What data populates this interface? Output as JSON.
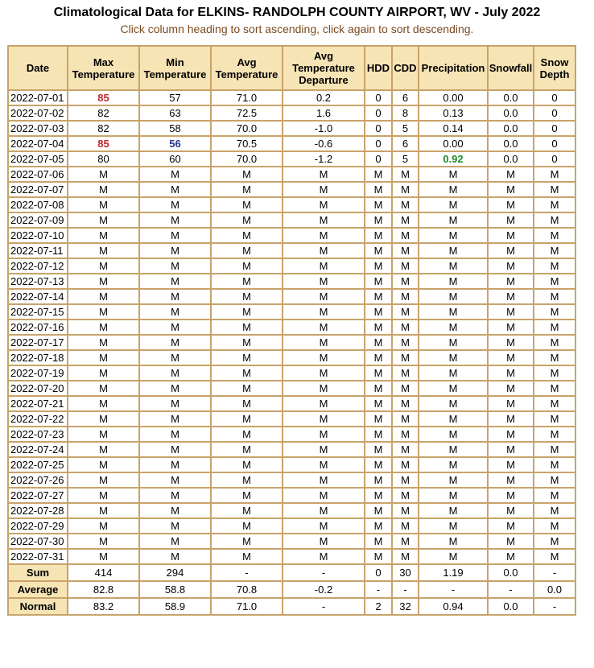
{
  "header": {
    "title": "Climatological Data for ELKINS- RANDOLPH COUNTY AIRPORT, WV - July 2022",
    "subtitle": "Click column heading to sort ascending, click again to sort descending."
  },
  "columns": [
    [
      "Date"
    ],
    [
      "Max",
      "Temperature"
    ],
    [
      "Min",
      "Temperature"
    ],
    [
      "Avg",
      "Temperature"
    ],
    [
      "Avg",
      "Temperature",
      "Departure"
    ],
    [
      "HDD"
    ],
    [
      "CDD"
    ],
    [
      "Precipitation"
    ],
    [
      "Snowfall"
    ],
    [
      "Snow",
      "Depth"
    ]
  ],
  "highlights": {
    "max_color": "#c0262b",
    "min_color": "#27338f",
    "precip_color": "#1e8a2e"
  },
  "rows": [
    {
      "cells": [
        "2022-07-01",
        "85",
        "57",
        "71.0",
        "0.2",
        "0",
        "6",
        "0.00",
        "0.0",
        "0"
      ],
      "hl": {
        "1": "hi"
      }
    },
    {
      "cells": [
        "2022-07-02",
        "82",
        "63",
        "72.5",
        "1.6",
        "0",
        "8",
        "0.13",
        "0.0",
        "0"
      ]
    },
    {
      "cells": [
        "2022-07-03",
        "82",
        "58",
        "70.0",
        "-1.0",
        "0",
        "5",
        "0.14",
        "0.0",
        "0"
      ]
    },
    {
      "cells": [
        "2022-07-04",
        "85",
        "56",
        "70.5",
        "-0.6",
        "0",
        "6",
        "0.00",
        "0.0",
        "0"
      ],
      "hl": {
        "1": "hi",
        "2": "lo"
      }
    },
    {
      "cells": [
        "2022-07-05",
        "80",
        "60",
        "70.0",
        "-1.2",
        "0",
        "5",
        "0.92",
        "0.0",
        "0"
      ],
      "hl": {
        "7": "pr"
      }
    },
    {
      "cells": [
        "2022-07-06",
        "M",
        "M",
        "M",
        "M",
        "M",
        "M",
        "M",
        "M",
        "M"
      ]
    },
    {
      "cells": [
        "2022-07-07",
        "M",
        "M",
        "M",
        "M",
        "M",
        "M",
        "M",
        "M",
        "M"
      ]
    },
    {
      "cells": [
        "2022-07-08",
        "M",
        "M",
        "M",
        "M",
        "M",
        "M",
        "M",
        "M",
        "M"
      ]
    },
    {
      "cells": [
        "2022-07-09",
        "M",
        "M",
        "M",
        "M",
        "M",
        "M",
        "M",
        "M",
        "M"
      ]
    },
    {
      "cells": [
        "2022-07-10",
        "M",
        "M",
        "M",
        "M",
        "M",
        "M",
        "M",
        "M",
        "M"
      ]
    },
    {
      "cells": [
        "2022-07-11",
        "M",
        "M",
        "M",
        "M",
        "M",
        "M",
        "M",
        "M",
        "M"
      ]
    },
    {
      "cells": [
        "2022-07-12",
        "M",
        "M",
        "M",
        "M",
        "M",
        "M",
        "M",
        "M",
        "M"
      ]
    },
    {
      "cells": [
        "2022-07-13",
        "M",
        "M",
        "M",
        "M",
        "M",
        "M",
        "M",
        "M",
        "M"
      ]
    },
    {
      "cells": [
        "2022-07-14",
        "M",
        "M",
        "M",
        "M",
        "M",
        "M",
        "M",
        "M",
        "M"
      ]
    },
    {
      "cells": [
        "2022-07-15",
        "M",
        "M",
        "M",
        "M",
        "M",
        "M",
        "M",
        "M",
        "M"
      ]
    },
    {
      "cells": [
        "2022-07-16",
        "M",
        "M",
        "M",
        "M",
        "M",
        "M",
        "M",
        "M",
        "M"
      ]
    },
    {
      "cells": [
        "2022-07-17",
        "M",
        "M",
        "M",
        "M",
        "M",
        "M",
        "M",
        "M",
        "M"
      ]
    },
    {
      "cells": [
        "2022-07-18",
        "M",
        "M",
        "M",
        "M",
        "M",
        "M",
        "M",
        "M",
        "M"
      ]
    },
    {
      "cells": [
        "2022-07-19",
        "M",
        "M",
        "M",
        "M",
        "M",
        "M",
        "M",
        "M",
        "M"
      ]
    },
    {
      "cells": [
        "2022-07-20",
        "M",
        "M",
        "M",
        "M",
        "M",
        "M",
        "M",
        "M",
        "M"
      ]
    },
    {
      "cells": [
        "2022-07-21",
        "M",
        "M",
        "M",
        "M",
        "M",
        "M",
        "M",
        "M",
        "M"
      ]
    },
    {
      "cells": [
        "2022-07-22",
        "M",
        "M",
        "M",
        "M",
        "M",
        "M",
        "M",
        "M",
        "M"
      ]
    },
    {
      "cells": [
        "2022-07-23",
        "M",
        "M",
        "M",
        "M",
        "M",
        "M",
        "M",
        "M",
        "M"
      ]
    },
    {
      "cells": [
        "2022-07-24",
        "M",
        "M",
        "M",
        "M",
        "M",
        "M",
        "M",
        "M",
        "M"
      ]
    },
    {
      "cells": [
        "2022-07-25",
        "M",
        "M",
        "M",
        "M",
        "M",
        "M",
        "M",
        "M",
        "M"
      ]
    },
    {
      "cells": [
        "2022-07-26",
        "M",
        "M",
        "M",
        "M",
        "M",
        "M",
        "M",
        "M",
        "M"
      ]
    },
    {
      "cells": [
        "2022-07-27",
        "M",
        "M",
        "M",
        "M",
        "M",
        "M",
        "M",
        "M",
        "M"
      ]
    },
    {
      "cells": [
        "2022-07-28",
        "M",
        "M",
        "M",
        "M",
        "M",
        "M",
        "M",
        "M",
        "M"
      ]
    },
    {
      "cells": [
        "2022-07-29",
        "M",
        "M",
        "M",
        "M",
        "M",
        "M",
        "M",
        "M",
        "M"
      ]
    },
    {
      "cells": [
        "2022-07-30",
        "M",
        "M",
        "M",
        "M",
        "M",
        "M",
        "M",
        "M",
        "M"
      ]
    },
    {
      "cells": [
        "2022-07-31",
        "M",
        "M",
        "M",
        "M",
        "M",
        "M",
        "M",
        "M",
        "M"
      ]
    }
  ],
  "summary": [
    {
      "cells": [
        "Sum",
        "414",
        "294",
        "-",
        "-",
        "0",
        "30",
        "1.19",
        "0.0",
        "-"
      ]
    },
    {
      "cells": [
        "Average",
        "82.8",
        "58.8",
        "70.8",
        "-0.2",
        "-",
        "-",
        "-",
        "-",
        "0.0"
      ]
    },
    {
      "cells": [
        "Normal",
        "83.2",
        "58.9",
        "71.0",
        "-",
        "2",
        "32",
        "0.94",
        "0.0",
        "-"
      ]
    }
  ]
}
